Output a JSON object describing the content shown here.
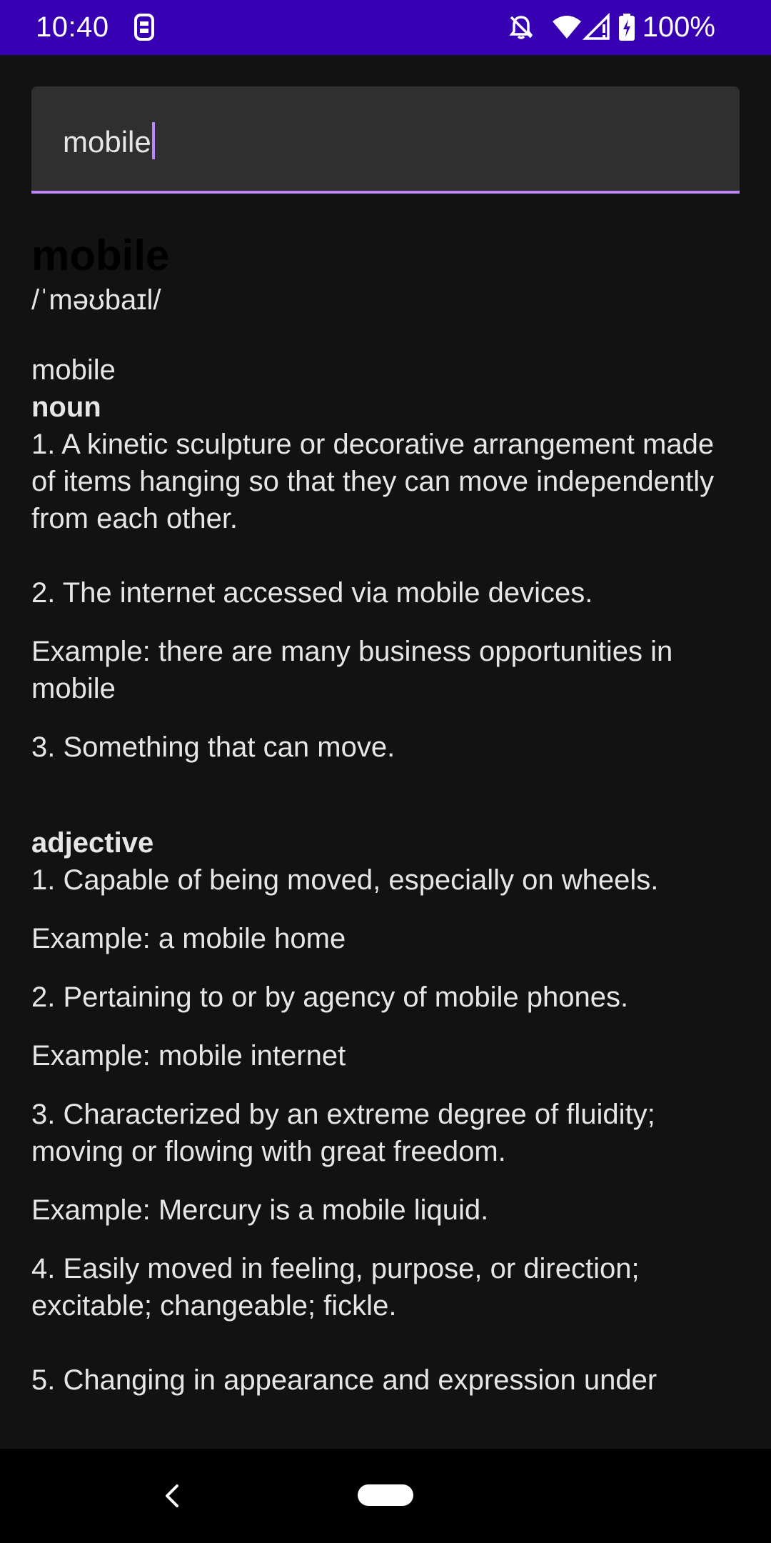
{
  "status_bar": {
    "time": "10:40",
    "battery": "100%",
    "icons": [
      "sim-card-icon",
      "bell-off-icon",
      "wifi-icon",
      "signal-icon",
      "battery-charging-icon"
    ]
  },
  "search": {
    "value": "mobile"
  },
  "entry": {
    "title": "mobile",
    "phonetic": "/ˈməʊbaɪl/",
    "word": "mobile",
    "noun": {
      "label": "noun",
      "d1": "1. A kinetic sculpture or decorative arrangement made of items hanging so that they can move independently from each other.",
      "d2": "2. The internet accessed via mobile devices.",
      "e2": "Example: there are many business opportunities in mobile",
      "d3": "3. Something that can move."
    },
    "adjective": {
      "label": "adjective",
      "d1": "1. Capable of being moved, especially on wheels.",
      "e1": "Example: a mobile home",
      "d2": "2. Pertaining to or by agency of mobile phones.",
      "e2": "Example: mobile internet",
      "d3": "3. Characterized by an extreme degree of fluidity; moving or flowing with great freedom.",
      "e3": "Example: Mercury is a mobile liquid.",
      "d4": "4. Easily moved in feeling, purpose, or direction; excitable; changeable; fickle.",
      "d5": "5. Changing in appearance and expression under"
    }
  },
  "colors": {
    "status_bar": "#3700b3",
    "accent": "#bb86fc",
    "background": "#121212",
    "field": "#2f2f2f",
    "text": "#e6e6e6"
  }
}
